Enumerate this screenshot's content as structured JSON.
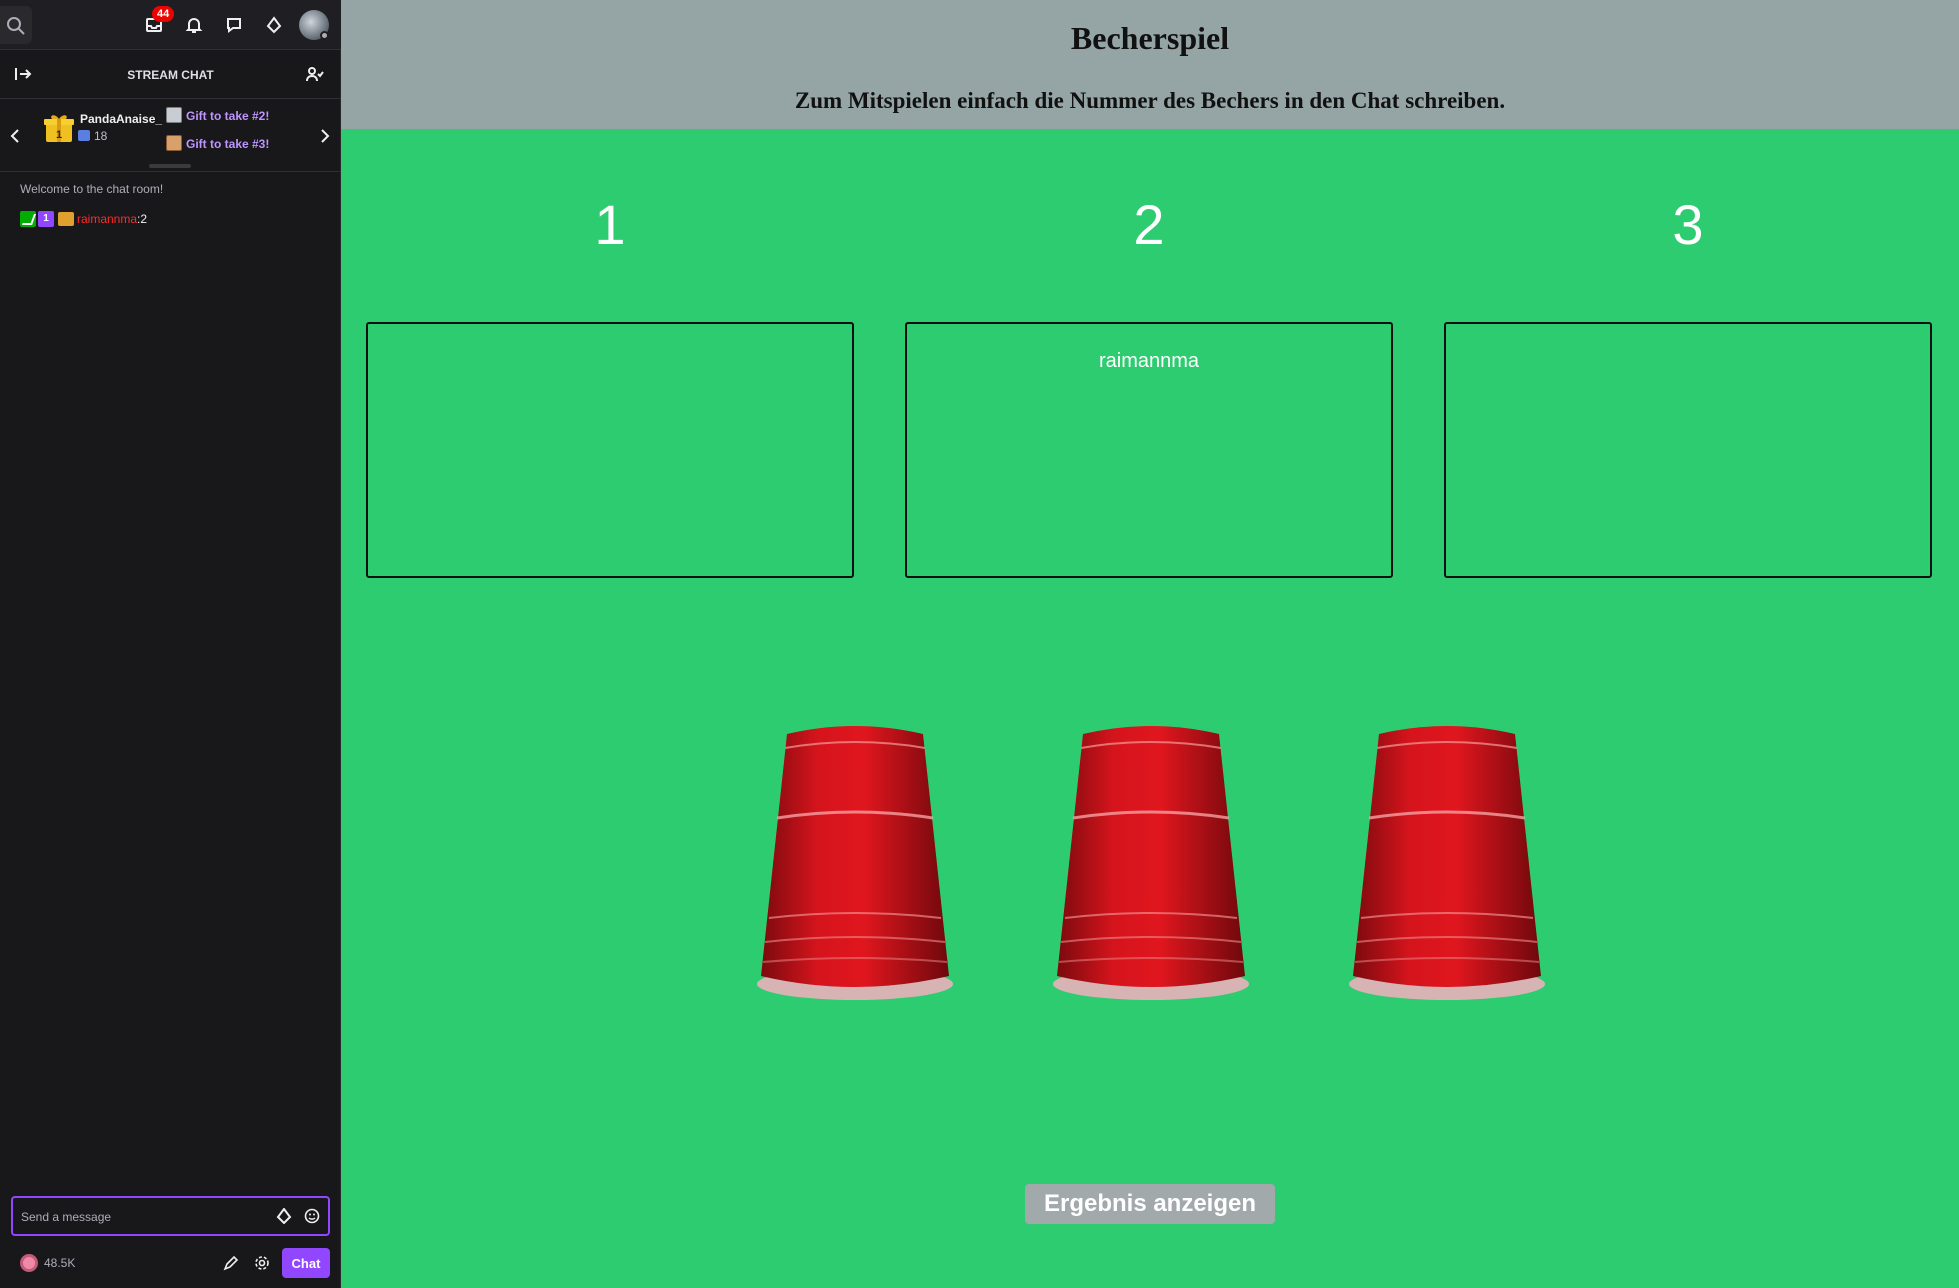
{
  "topbar": {
    "inbox_count": "44"
  },
  "chat": {
    "header_title": "STREAM CHAT",
    "gift": {
      "user": "PandaAnaise_",
      "count": "18",
      "gift_tier": "1",
      "take_2": "Gift to take #2!",
      "take_3": "Gift to take #3!"
    },
    "welcome": "Welcome to the chat room!",
    "message": {
      "sub_badge": "1",
      "username": "raimannma",
      "separator": ": ",
      "text": "2"
    },
    "input_placeholder": "Send a message",
    "points": "48.5K",
    "send_label": "Chat"
  },
  "game": {
    "title": "Becherspiel",
    "instruction": "Zum Mitspielen einfach die Nummer des Bechers in den Chat schreiben.",
    "cups": [
      {
        "number": "1",
        "players": ""
      },
      {
        "number": "2",
        "players": "raimannma"
      },
      {
        "number": "3",
        "players": ""
      }
    ],
    "result_button": "Ergebnis anzeigen",
    "colors": {
      "background": "#2ecc71",
      "header": "#95a5a6",
      "cup": "#c8131b"
    }
  }
}
